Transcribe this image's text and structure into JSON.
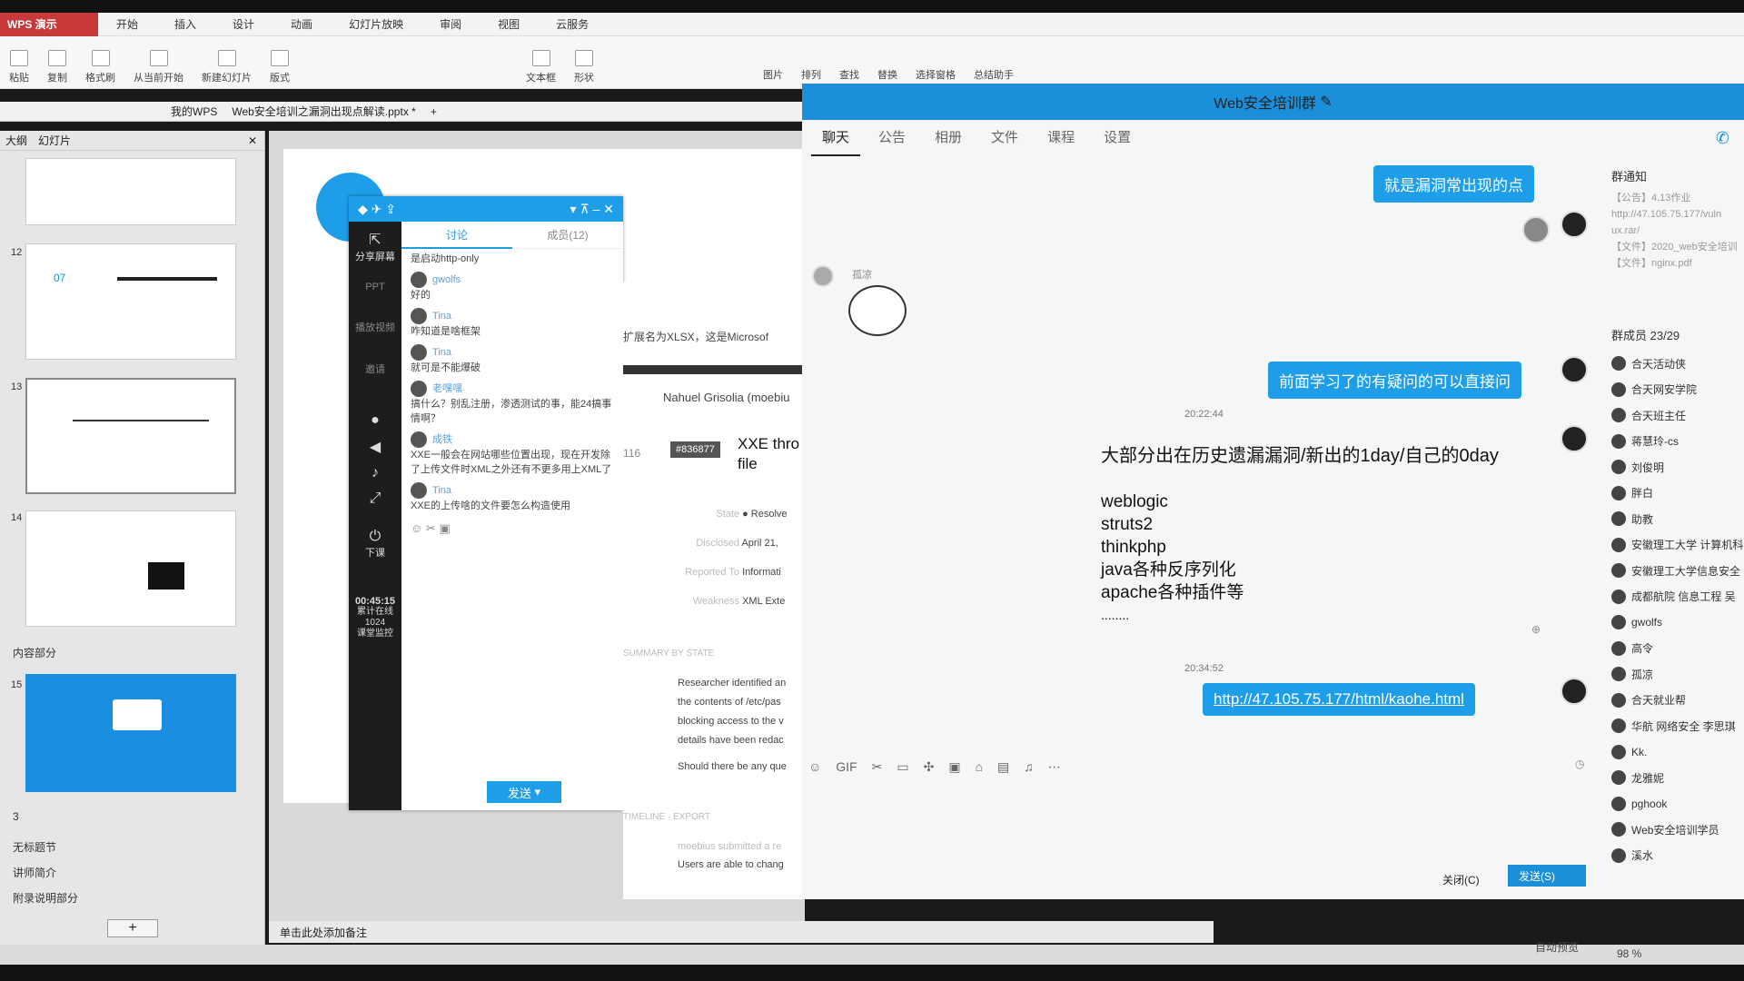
{
  "wps": {
    "app_name": "WPS 演示",
    "menus": [
      "开始",
      "插入",
      "设计",
      "动画",
      "幻灯片放映",
      "审阅",
      "视图",
      "云服务"
    ],
    "ribbon_labels": [
      "粘贴",
      "复制",
      "格式刷",
      "从当前开始",
      "新建幻灯片",
      "版式",
      "文本框",
      "形状",
      "排列",
      "替换",
      "选择窗格",
      "总结助手"
    ],
    "ribbon_right": [
      "图片",
      "查找"
    ],
    "tabs": [
      "我的WPS",
      "Web安全培训之漏洞出现点解读.pptx *"
    ],
    "left_tabs": [
      "大纲",
      "幻灯片"
    ],
    "slide_numbers": [
      "12",
      "13",
      "14",
      "15"
    ],
    "thumb12_text": "07",
    "sections": [
      "内容部分",
      "3",
      "无标题节",
      "讲师简介",
      "附录说明部分"
    ],
    "notes_placeholder": "单击此处添加备注",
    "status_right": "自动预览",
    "zoom": "98 %"
  },
  "qq_small": {
    "tabs": [
      "讨论",
      "成员(12)"
    ],
    "side_items": [
      "分享屏幕",
      "PPT",
      "播放视频",
      "邀请"
    ],
    "side_bottom": [
      "下课"
    ],
    "timer": "00:45:15",
    "stats": [
      "累计在线",
      "1024",
      "课堂监控"
    ],
    "messages": [
      {
        "name": "",
        "text": "是启动http-only"
      },
      {
        "name": "gwolfs",
        "text": "好的"
      },
      {
        "name": "Tina",
        "text": "咋知道是啥框架"
      },
      {
        "name": "Tina",
        "text": "就可是不能爆破"
      },
      {
        "name": "老嘿嘿",
        "text": "搞什么？别乱注册，渗透测试的事，能24搞事情啊？"
      },
      {
        "name": "成铁",
        "text": "XXE一般会在网站哪些位置出现，现在开发除了上传文件时XML之外还有不更多用上XML了"
      },
      {
        "name": "Tina",
        "text": "XXE的上传啥的文件要怎么构造使用"
      }
    ],
    "send_label": "发送"
  },
  "web_fragment": {
    "line1": "扩展名为XLSX，这是Microsof",
    "author": "Nahuel Grisolia (moebiu",
    "votes": "116",
    "report_id": "#836877",
    "title": "XXE thro file",
    "fields": [
      {
        "label": "State",
        "value": "● Resolve"
      },
      {
        "label": "Disclosed",
        "value": "April 21,"
      },
      {
        "label": "Reported To",
        "value": "Informati"
      },
      {
        "label": "Weakness",
        "value": "XML Exte"
      }
    ],
    "summary": "SUMMARY BY STATE",
    "body": [
      "Researcher identified an",
      "the contents of /etc/pas",
      "blocking access to the v",
      "details have been redac",
      "Should there be any que"
    ],
    "timeline": "TIMELINE · EXPORT",
    "tl_author": "moebius submitted a re",
    "tl_text": "Users are able to chang"
  },
  "group": {
    "title": "Web安全培训群",
    "tabs": [
      "聊天",
      "公告",
      "相册",
      "文件",
      "课程",
      "设置"
    ],
    "msg1": "就是漏洞常出现的点",
    "sender_guliang": "孤凉",
    "msg2": "前面学习了的有疑问的可以直接问",
    "time1": "20:22:44",
    "bigtext_title": "大部分出在历史遗漏漏洞/新出的1day/自己的0day",
    "bigtext_list": [
      "weblogic",
      "struts2",
      "thinkphp",
      "java各种反序列化",
      "apache各种插件等",
      "........"
    ],
    "time2": "20:34:52",
    "link": "http://47.105.75.177/html/kaohe.html",
    "close_btn": "关闭(C)",
    "send_btn": "发送(S)",
    "notice_head": "群通知",
    "notice_items": [
      "【公告】4.13作业",
      "http://47.105.75.177/vuln",
      "ux.rar/",
      "【文件】2020_web安全培训",
      "【文件】nginx.pdf"
    ],
    "members_head": "群成员 23/29",
    "members": [
      "合天活动侠",
      "合天网安学院",
      "合天班主任",
      "蒋慧玲-cs",
      "刘俊明",
      "胖白",
      "助教",
      "安徽理工大学 计算机科",
      "安徽理工大学信息安全",
      "成都航院 信息工程 吴",
      "gwolfs",
      "高令",
      "孤凉",
      "合天就业帮",
      "华航 网络安全 李思琪",
      "Kk.",
      "龙雅妮",
      "pghook",
      "Web安全培训学员",
      "溪水"
    ]
  }
}
